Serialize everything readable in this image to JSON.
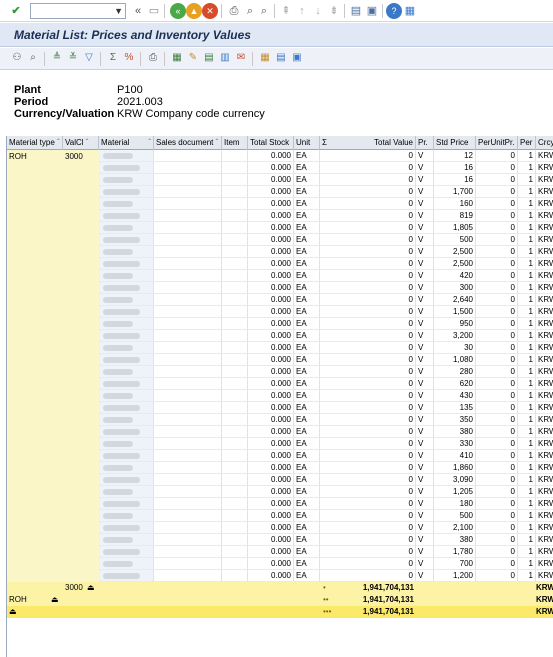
{
  "toolbar": {
    "check_icon": "check-icon",
    "command_value": "",
    "nav": [
      "back-icon",
      "exit-icon",
      "cancel-icon"
    ]
  },
  "title": "Material List: Prices and Inventory Values",
  "header": {
    "plant_label": "Plant",
    "plant_value": "P100",
    "period_label": "Period",
    "period_value": "2021.003",
    "cv_label": "Currency/Valuation",
    "cv_value": "KRW Company code currency"
  },
  "columns": {
    "material_type": "Material type",
    "valcl": "ValCl",
    "material": "Material",
    "sales_doc": "Sales document",
    "item": "Item",
    "total_stock": "Total Stock",
    "unit": "Unit",
    "sigma": "Σ",
    "total_value": "Total Value",
    "pr": "Pr.",
    "std_price": "Std Price",
    "per_unit_pr": "PerUnitPr.",
    "per": "Per",
    "crcy": "Crcy"
  },
  "first_row": {
    "material_type": "ROH",
    "valcl": "3000"
  },
  "rows": [
    {
      "stock": "0.000",
      "unit": "EA",
      "value": "0",
      "pr": "V",
      "std": "12",
      "pup": "0",
      "per": "1",
      "crcy": "KRW"
    },
    {
      "stock": "0.000",
      "unit": "EA",
      "value": "0",
      "pr": "V",
      "std": "16",
      "pup": "0",
      "per": "1",
      "crcy": "KRW"
    },
    {
      "stock": "0.000",
      "unit": "EA",
      "value": "0",
      "pr": "V",
      "std": "16",
      "pup": "0",
      "per": "1",
      "crcy": "KRW"
    },
    {
      "stock": "0.000",
      "unit": "EA",
      "value": "0",
      "pr": "V",
      "std": "1,700",
      "pup": "0",
      "per": "1",
      "crcy": "KRW"
    },
    {
      "stock": "0.000",
      "unit": "EA",
      "value": "0",
      "pr": "V",
      "std": "160",
      "pup": "0",
      "per": "1",
      "crcy": "KRW"
    },
    {
      "stock": "0.000",
      "unit": "EA",
      "value": "0",
      "pr": "V",
      "std": "819",
      "pup": "0",
      "per": "1",
      "crcy": "KRW"
    },
    {
      "stock": "0.000",
      "unit": "EA",
      "value": "0",
      "pr": "V",
      "std": "1,805",
      "pup": "0",
      "per": "1",
      "crcy": "KRW"
    },
    {
      "stock": "0.000",
      "unit": "EA",
      "value": "0",
      "pr": "V",
      "std": "500",
      "pup": "0",
      "per": "1",
      "crcy": "KRW"
    },
    {
      "stock": "0.000",
      "unit": "EA",
      "value": "0",
      "pr": "V",
      "std": "2,500",
      "pup": "0",
      "per": "1",
      "crcy": "KRW"
    },
    {
      "stock": "0.000",
      "unit": "EA",
      "value": "0",
      "pr": "V",
      "std": "2,500",
      "pup": "0",
      "per": "1",
      "crcy": "KRW"
    },
    {
      "stock": "0.000",
      "unit": "EA",
      "value": "0",
      "pr": "V",
      "std": "420",
      "pup": "0",
      "per": "1",
      "crcy": "KRW"
    },
    {
      "stock": "0.000",
      "unit": "EA",
      "value": "0",
      "pr": "V",
      "std": "300",
      "pup": "0",
      "per": "1",
      "crcy": "KRW"
    },
    {
      "stock": "0.000",
      "unit": "EA",
      "value": "0",
      "pr": "V",
      "std": "2,640",
      "pup": "0",
      "per": "1",
      "crcy": "KRW"
    },
    {
      "stock": "0.000",
      "unit": "EA",
      "value": "0",
      "pr": "V",
      "std": "1,500",
      "pup": "0",
      "per": "1",
      "crcy": "KRW"
    },
    {
      "stock": "0.000",
      "unit": "EA",
      "value": "0",
      "pr": "V",
      "std": "950",
      "pup": "0",
      "per": "1",
      "crcy": "KRW"
    },
    {
      "stock": "0.000",
      "unit": "EA",
      "value": "0",
      "pr": "V",
      "std": "3,200",
      "pup": "0",
      "per": "1",
      "crcy": "KRW"
    },
    {
      "stock": "0.000",
      "unit": "EA",
      "value": "0",
      "pr": "V",
      "std": "30",
      "pup": "0",
      "per": "1",
      "crcy": "KRW"
    },
    {
      "stock": "0.000",
      "unit": "EA",
      "value": "0",
      "pr": "V",
      "std": "1,080",
      "pup": "0",
      "per": "1",
      "crcy": "KRW"
    },
    {
      "stock": "0.000",
      "unit": "EA",
      "value": "0",
      "pr": "V",
      "std": "280",
      "pup": "0",
      "per": "1",
      "crcy": "KRW"
    },
    {
      "stock": "0.000",
      "unit": "EA",
      "value": "0",
      "pr": "V",
      "std": "620",
      "pup": "0",
      "per": "1",
      "crcy": "KRW"
    },
    {
      "stock": "0.000",
      "unit": "EA",
      "value": "0",
      "pr": "V",
      "std": "430",
      "pup": "0",
      "per": "1",
      "crcy": "KRW"
    },
    {
      "stock": "0.000",
      "unit": "EA",
      "value": "0",
      "pr": "V",
      "std": "135",
      "pup": "0",
      "per": "1",
      "crcy": "KRW"
    },
    {
      "stock": "0.000",
      "unit": "EA",
      "value": "0",
      "pr": "V",
      "std": "350",
      "pup": "0",
      "per": "1",
      "crcy": "KRW"
    },
    {
      "stock": "0.000",
      "unit": "EA",
      "value": "0",
      "pr": "V",
      "std": "380",
      "pup": "0",
      "per": "1",
      "crcy": "KRW"
    },
    {
      "stock": "0.000",
      "unit": "EA",
      "value": "0",
      "pr": "V",
      "std": "330",
      "pup": "0",
      "per": "1",
      "crcy": "KRW"
    },
    {
      "stock": "0.000",
      "unit": "EA",
      "value": "0",
      "pr": "V",
      "std": "410",
      "pup": "0",
      "per": "1",
      "crcy": "KRW"
    },
    {
      "stock": "0.000",
      "unit": "EA",
      "value": "0",
      "pr": "V",
      "std": "1,860",
      "pup": "0",
      "per": "1",
      "crcy": "KRW"
    },
    {
      "stock": "0.000",
      "unit": "EA",
      "value": "0",
      "pr": "V",
      "std": "3,090",
      "pup": "0",
      "per": "1",
      "crcy": "KRW"
    },
    {
      "stock": "0.000",
      "unit": "EA",
      "value": "0",
      "pr": "V",
      "std": "1,205",
      "pup": "0",
      "per": "1",
      "crcy": "KRW"
    },
    {
      "stock": "0.000",
      "unit": "EA",
      "value": "0",
      "pr": "V",
      "std": "180",
      "pup": "0",
      "per": "1",
      "crcy": "KRW"
    },
    {
      "stock": "0.000",
      "unit": "EA",
      "value": "0",
      "pr": "V",
      "std": "500",
      "pup": "0",
      "per": "1",
      "crcy": "KRW"
    },
    {
      "stock": "0.000",
      "unit": "EA",
      "value": "0",
      "pr": "V",
      "std": "2,100",
      "pup": "0",
      "per": "1",
      "crcy": "KRW"
    },
    {
      "stock": "0.000",
      "unit": "EA",
      "value": "0",
      "pr": "V",
      "std": "380",
      "pup": "0",
      "per": "1",
      "crcy": "KRW"
    },
    {
      "stock": "0.000",
      "unit": "EA",
      "value": "0",
      "pr": "V",
      "std": "1,780",
      "pup": "0",
      "per": "1",
      "crcy": "KRW"
    },
    {
      "stock": "0.000",
      "unit": "EA",
      "value": "0",
      "pr": "V",
      "std": "700",
      "pup": "0",
      "per": "1",
      "crcy": "KRW"
    },
    {
      "stock": "0.000",
      "unit": "EA",
      "value": "0",
      "pr": "V",
      "std": "1,200",
      "pup": "0",
      "per": "1",
      "crcy": "KRW"
    }
  ],
  "subtotals": [
    {
      "label_valcl": "3000",
      "label_mt": "",
      "marker": "•",
      "value": "1,941,704,131",
      "crcy": "KRW"
    },
    {
      "label_valcl": "",
      "label_mt": "ROH",
      "marker": "••",
      "value": "1,941,704,131",
      "crcy": "KRW"
    },
    {
      "label_valcl": "",
      "label_mt": "",
      "marker": "•••",
      "value": "1,941,704,131",
      "crcy": "KRW"
    }
  ],
  "colors": {
    "title_bg": "#dfe8f4",
    "sum_bg": "#fdf3a6",
    "grand_bg": "#fbe96a",
    "key_col": "#fbf6c8"
  }
}
